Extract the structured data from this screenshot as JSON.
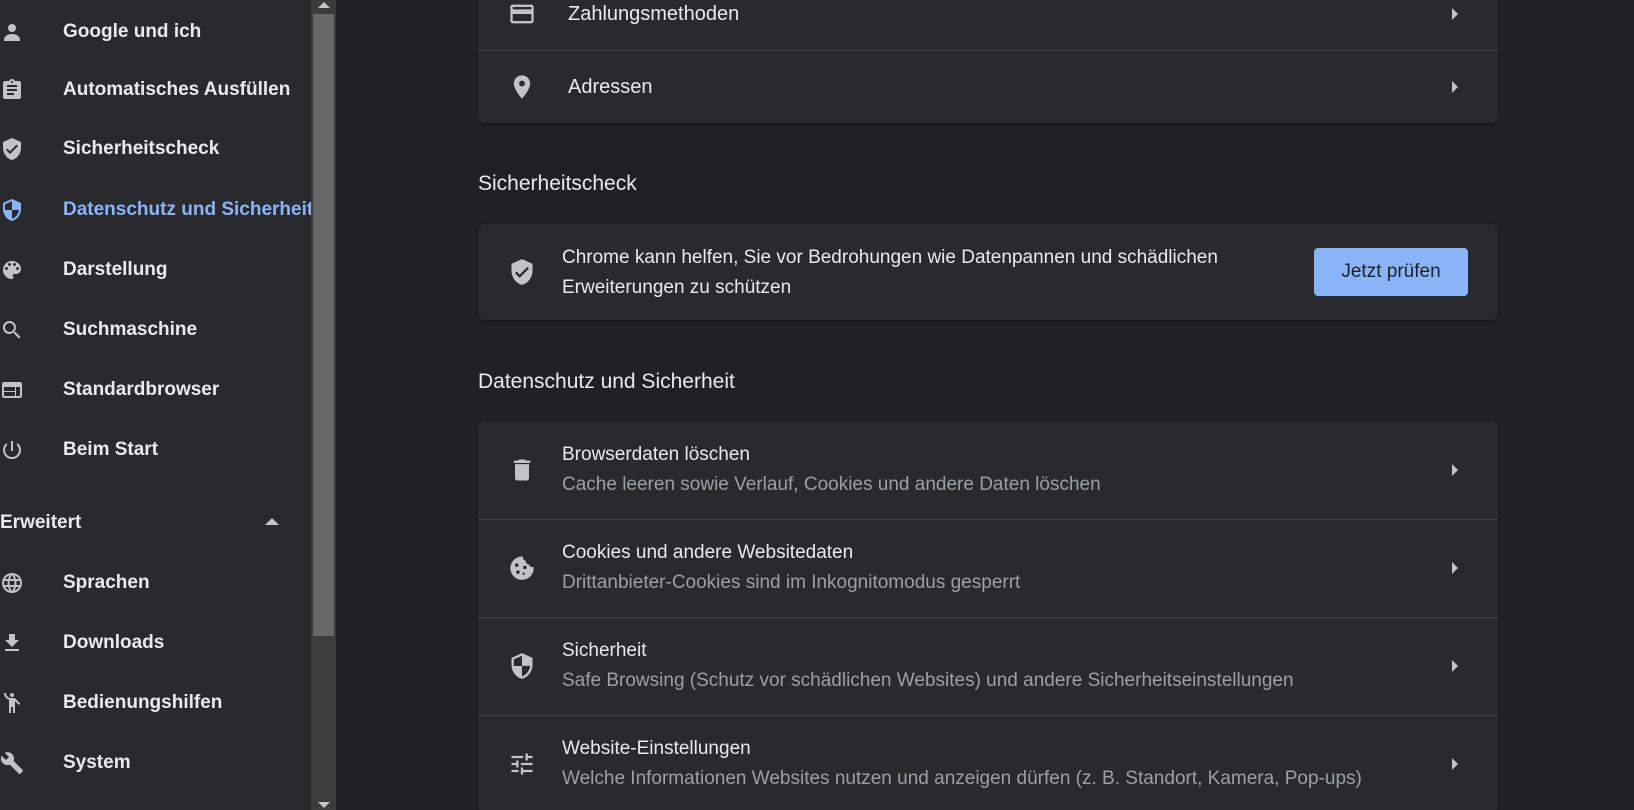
{
  "sidebar": {
    "items": [
      {
        "label": "Google und ich",
        "icon": "person-icon"
      },
      {
        "label": "Automatisches Ausfüllen",
        "icon": "clipboard-icon"
      },
      {
        "label": "Sicherheitscheck",
        "icon": "shield-check-icon"
      },
      {
        "label": "Datenschutz und Sicherheit",
        "icon": "shield-half-icon",
        "active": true
      },
      {
        "label": "Darstellung",
        "icon": "palette-icon"
      },
      {
        "label": "Suchmaschine",
        "icon": "search-icon"
      },
      {
        "label": "Standardbrowser",
        "icon": "browser-window-icon"
      },
      {
        "label": "Beim Start",
        "icon": "power-icon"
      }
    ],
    "advanced_label": "Erweitert",
    "advanced_items": [
      {
        "label": "Sprachen",
        "icon": "globe-icon"
      },
      {
        "label": "Downloads",
        "icon": "download-icon"
      },
      {
        "label": "Bedienungshilfen",
        "icon": "accessibility-icon"
      },
      {
        "label": "System",
        "icon": "wrench-icon"
      }
    ]
  },
  "autofill": {
    "payment_label": "Zahlungsmethoden",
    "addresses_label": "Adressen"
  },
  "safety_check": {
    "heading": "Sicherheitscheck",
    "text": "Chrome kann helfen, Sie vor Bedrohungen wie Datenpannen und schädlichen Erweiterungen zu schützen",
    "button_label": "Jetzt prüfen"
  },
  "privacy": {
    "heading": "Datenschutz und Sicherheit",
    "rows": [
      {
        "title": "Browserdaten löschen",
        "subtitle": "Cache leeren sowie Verlauf, Cookies und andere Daten löschen",
        "icon": "trash-icon"
      },
      {
        "title": "Cookies und andere Websitedaten",
        "subtitle": "Drittanbieter-Cookies sind im Inkognitomodus gesperrt",
        "icon": "cookie-icon"
      },
      {
        "title": "Sicherheit",
        "subtitle": "Safe Browsing (Schutz vor schädlichen Websites) und andere Sicherheitseinstellungen",
        "icon": "shield-half-icon"
      },
      {
        "title": "Website-Einstellungen",
        "subtitle": "Welche Informationen Websites nutzen und anzeigen dürfen (z. B. Standort, Kamera, Pop-ups)",
        "icon": "sliders-icon"
      }
    ]
  },
  "colors": {
    "accent": "#8ab4f8",
    "background": "#202124",
    "surface": "#292a2d"
  }
}
